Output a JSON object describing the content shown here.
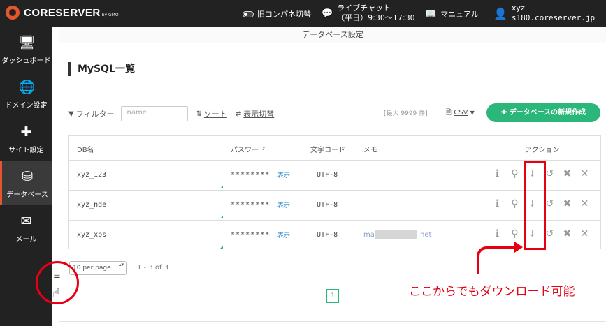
{
  "header": {
    "brand": "CORESERVER",
    "brand_sub": "by GMO",
    "old_panel_toggle": "旧コンパネ切替",
    "chat_label": "ライブチャット",
    "chat_hours": "（平日）9:30～17:30",
    "manual": "マニュアル",
    "user_name": "xyz",
    "server": "s180.coreserver.jp"
  },
  "sidebar": {
    "items": [
      {
        "label": "ダッシュボード",
        "icon": "monitor-icon"
      },
      {
        "label": "ドメイン設定",
        "icon": "globe-icon"
      },
      {
        "label": "サイト設定",
        "icon": "grid-plus-icon"
      },
      {
        "label": "データベース",
        "icon": "database-icon"
      },
      {
        "label": "メール",
        "icon": "mail-icon"
      }
    ],
    "active": "データベース",
    "toggle_icon": "hamburger-icon"
  },
  "page": {
    "section_title": "データベース設定",
    "title": "MySQL一覧"
  },
  "toolbar": {
    "filter_label": "フィルター",
    "filter_placeholder": "name",
    "sort_label": "ソート",
    "display_toggle": "表示切替",
    "max_count": "[最大 9999 件]",
    "csv_label": "CSV",
    "new_button": "データベースの新規作成"
  },
  "table": {
    "columns": [
      "DB名",
      "パスワード",
      "文字コード",
      "メモ",
      "アクション"
    ],
    "show_label": "表示",
    "rows": [
      {
        "db": "xyz_123",
        "password": "********",
        "charset": "UTF-8",
        "memo_prefix": "",
        "memo_suffix": ""
      },
      {
        "db": "xyz_nde",
        "password": "********",
        "charset": "UTF-8",
        "memo_prefix": "",
        "memo_suffix": ""
      },
      {
        "db": "xyz_xbs",
        "password": "********",
        "charset": "UTF-8",
        "memo_prefix": "ma",
        "memo_suffix": ".net"
      }
    ],
    "action_icons": [
      "info-icon",
      "key-icon",
      "download-icon",
      "restore-icon",
      "tools-icon",
      "delete-icon"
    ]
  },
  "pagination": {
    "per_page": "10 per page",
    "range": "1 - 3 of 3",
    "current_page": "1"
  },
  "annotation": {
    "text": "ここからでもダウンロード可能",
    "color": "#e60012"
  },
  "colors": {
    "accent": "#2bb67a",
    "brand": "#e4572e",
    "sidebar": "#222222"
  }
}
